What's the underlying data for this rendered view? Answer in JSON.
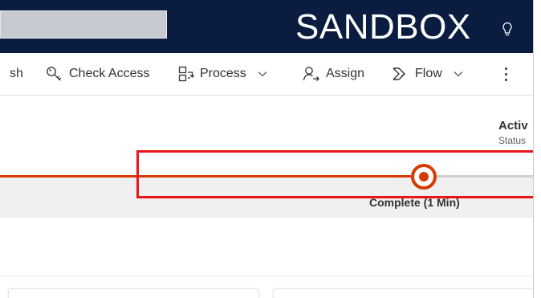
{
  "header": {
    "environment_label": "SANDBOX",
    "search": {
      "value": ""
    },
    "icons": {
      "lightbulb": "lightbulb-icon"
    }
  },
  "commandbar": {
    "items": [
      {
        "label": "sh",
        "icon": null
      },
      {
        "label": "Check Access",
        "icon": "key-icon"
      },
      {
        "label": "Process",
        "icon": "process-icon",
        "has_dropdown": true
      },
      {
        "label": "Assign",
        "icon": "assign-icon"
      },
      {
        "label": "Flow",
        "icon": "flow-icon",
        "has_dropdown": true
      }
    ],
    "more_icon": "more-vertical-icon"
  },
  "record_header": {
    "status_value": "Activ",
    "status_label": "Status"
  },
  "process_bar": {
    "active_stage_label": "Complete  (1 Min)"
  },
  "colors": {
    "header_bg": "#0a1c3f",
    "accent": "#d83b01",
    "highlight": "#e8161b",
    "band_bg": "#f0f0f0"
  }
}
